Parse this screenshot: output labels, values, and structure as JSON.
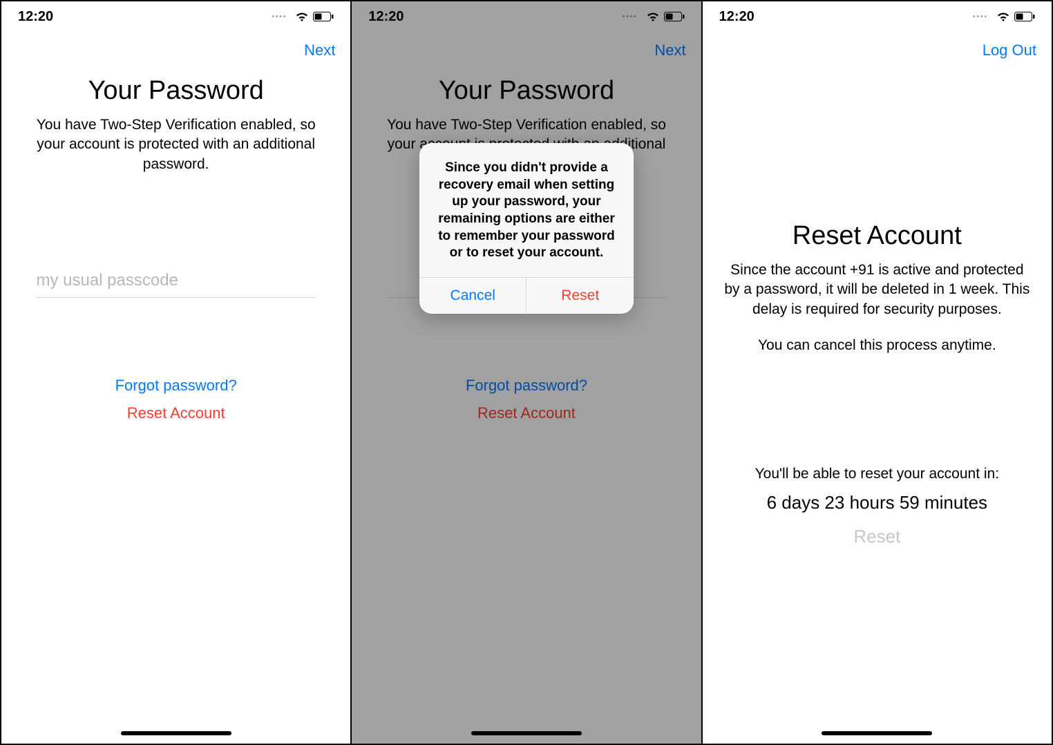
{
  "status": {
    "time": "12:20"
  },
  "screen1": {
    "nav": {
      "next": "Next"
    },
    "title": "Your Password",
    "subtitle": "You have Two-Step Verification enabled, so your account is protected with an additional password.",
    "input_value": "my usual passcode",
    "forgot": "Forgot password?",
    "reset": "Reset Account"
  },
  "screen2": {
    "nav": {
      "next": "Next"
    },
    "title": "Your Password",
    "subtitle": "You have Two-Step Verification enabled, so your account is protected with an additional password.",
    "forgot": "Forgot password?",
    "reset": "Reset Account",
    "alert": {
      "message": "Since you didn't provide a recovery email when setting up your password, your remaining options are either to remember your password or to reset your account.",
      "cancel": "Cancel",
      "reset": "Reset"
    }
  },
  "screen3": {
    "nav": {
      "logout": "Log Out"
    },
    "title": "Reset Account",
    "info": "Since the account +91                   is active and protected by a password, it will be deleted in 1 week. This delay is required for security purposes.",
    "cancel_note": "You can cancel this process anytime.",
    "countdown_label": "You'll be able to reset your account in:",
    "countdown": "6 days 23 hours 59 minutes",
    "reset": "Reset"
  }
}
